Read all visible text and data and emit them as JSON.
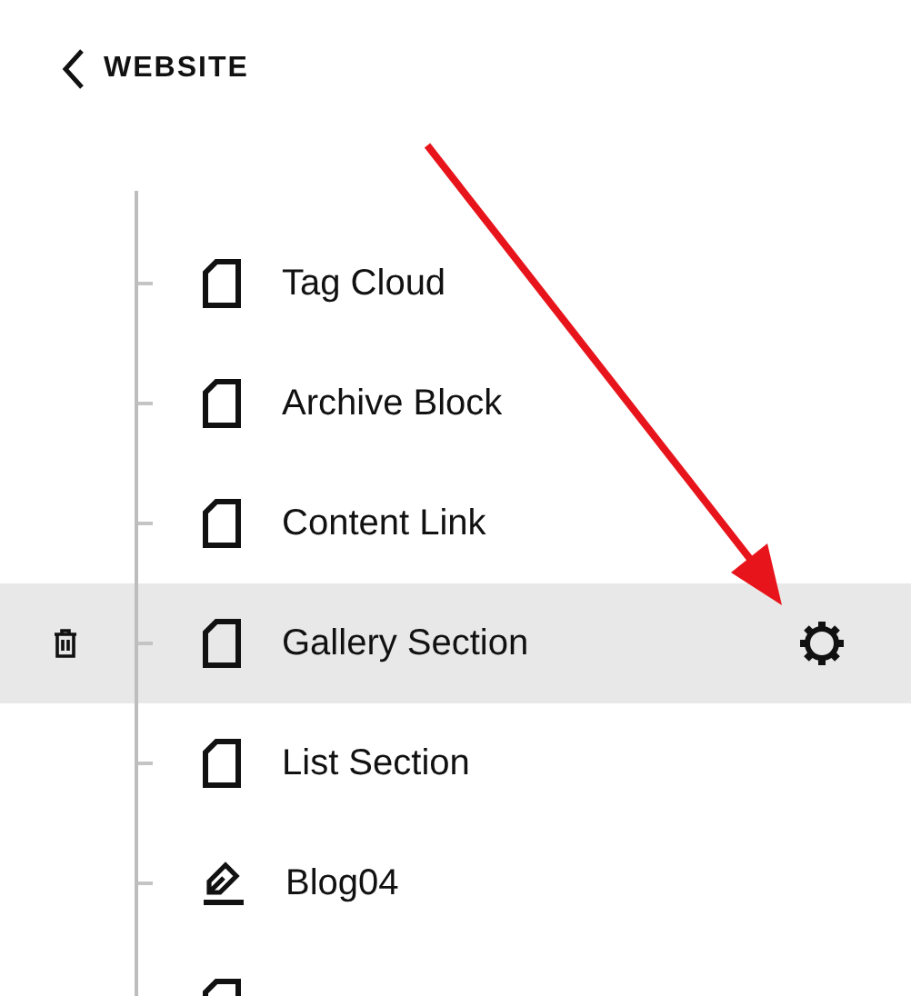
{
  "header": {
    "back_label": "WEBSITE"
  },
  "pages": [
    {
      "kind": "page",
      "label": "Tag Cloud",
      "selected": false
    },
    {
      "kind": "page",
      "label": "Archive Block",
      "selected": false
    },
    {
      "kind": "page",
      "label": "Content Link",
      "selected": false
    },
    {
      "kind": "page",
      "label": "Gallery Section",
      "selected": true
    },
    {
      "kind": "page",
      "label": "List Section",
      "selected": false
    },
    {
      "kind": "blog",
      "label": "Blog04",
      "selected": false
    },
    {
      "kind": "page",
      "selected": false
    }
  ]
}
